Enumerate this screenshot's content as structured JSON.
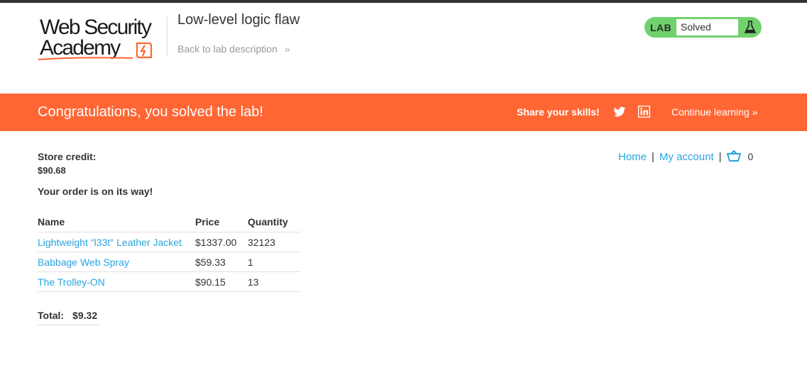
{
  "header": {
    "logo_line1": "Web Security",
    "logo_line2": "Academy",
    "lab_title": "Low-level logic flaw",
    "back_link": "Back to lab description",
    "lab_status_label": "LAB",
    "lab_status_value": "Solved"
  },
  "banner": {
    "message": "Congratulations, you solved the lab!",
    "share_text": "Share your skills!",
    "continue_link": "Continue learning",
    "icons": [
      "twitter-icon",
      "linkedin-icon",
      "chevron-right-icon"
    ]
  },
  "account": {
    "credit_label": "Store credit:",
    "credit_value": "$90.68",
    "order_message": "Your order is on its way!"
  },
  "nav": {
    "home": "Home",
    "separator": "|",
    "my_account": "My account",
    "cart_count": "0"
  },
  "order_table": {
    "headers": [
      "Name",
      "Price",
      "Quantity"
    ],
    "rows": [
      {
        "name": "Lightweight \"l33t\" Leather Jacket",
        "price": "$1337.00",
        "quantity": "32123"
      },
      {
        "name": "Babbage Web Spray",
        "price": "$59.33",
        "quantity": "1"
      },
      {
        "name": "The Trolley-ON",
        "price": "$90.15",
        "quantity": "13"
      }
    ]
  },
  "total": {
    "label": "Total:",
    "value": "$9.32"
  },
  "colors": {
    "accent_orange": "#ff6633",
    "link_blue": "#29a3e0",
    "lab_green": "#70d16d"
  }
}
